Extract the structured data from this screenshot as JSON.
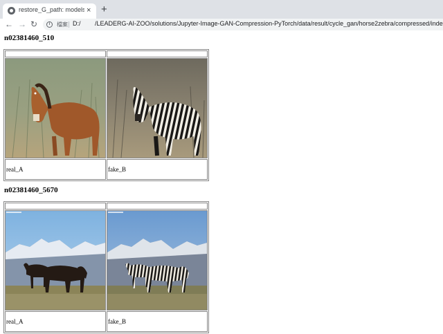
{
  "browser": {
    "tab_title": "restore_G_path: models/cycle_",
    "tab_close": "×",
    "new_tab": "+",
    "nav": {
      "back": "←",
      "forward": "→",
      "reload": "↻"
    },
    "address": {
      "info_glyph": "i",
      "file_label": "檔案",
      "drive": "D:/",
      "path": "/LEADERG-AI-ZOO/solutions/Jupyter-Image-GAN-Compression-PyTorch/data/result/cycle_gan/horse2zebra/compressed/index.html"
    }
  },
  "results": [
    {
      "heading": "n02381460_510",
      "images": [
        {
          "label": "real_A",
          "icon": "horse-photo"
        },
        {
          "label": "fake_B",
          "icon": "zebra-photo"
        }
      ]
    },
    {
      "heading": "n02381460_5670",
      "images": [
        {
          "label": "real_A",
          "icon": "horses-mountains-photo"
        },
        {
          "label": "fake_B",
          "icon": "zebras-mountains-photo"
        }
      ]
    }
  ]
}
